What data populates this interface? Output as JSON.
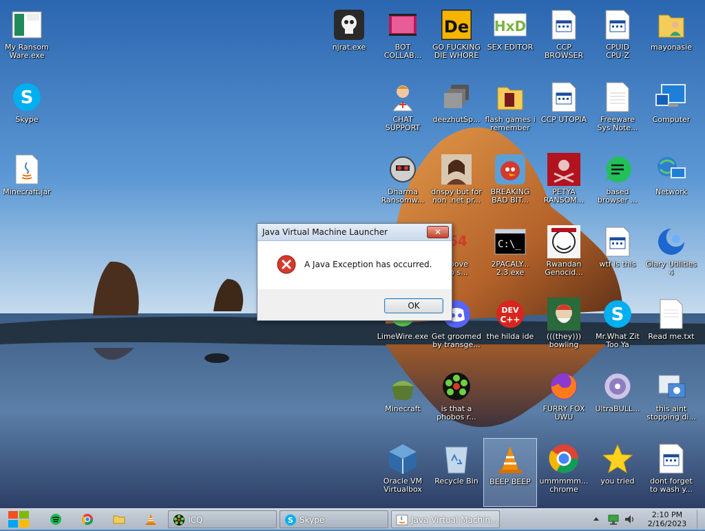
{
  "desktop": {
    "icons": [
      {
        "id": "my-ransomware",
        "label": "My Ransom\nWare.exe",
        "icon": "ransomware-app-icon"
      },
      {
        "id": "skype-left",
        "label": "Skype",
        "icon": "skype-icon"
      },
      {
        "id": "minecraft-jar",
        "label": "Minecraft.jar",
        "icon": "java-jar-icon"
      },
      {
        "id": "njrat",
        "label": "njrat.exe",
        "icon": "skull-icon"
      },
      {
        "id": "bot-collab",
        "label": "BOT\nCOLLAB...",
        "icon": "film-icon"
      },
      {
        "id": "go-fucking",
        "label": "GO FUCKING\nDIE WHORE",
        "icon": "de-logo-icon"
      },
      {
        "id": "sex-editor",
        "label": "SEX EDITOR",
        "icon": "hxd-icon"
      },
      {
        "id": "ccp-browser",
        "label": "CCP\nBROWSER",
        "icon": "app-window-icon"
      },
      {
        "id": "cpuid",
        "label": "CPUID\nCPU-Z",
        "icon": "app-window-icon"
      },
      {
        "id": "mayonasie",
        "label": "mayonasie",
        "icon": "user-folder-icon"
      },
      {
        "id": "chat-support",
        "label": "CHAT\nSUPPORT",
        "icon": "doctor-icon"
      },
      {
        "id": "deezhutsp",
        "label": "deezhutSp...",
        "icon": "stacked-windows-icon"
      },
      {
        "id": "flash-games",
        "label": "flash games i\nremember",
        "icon": "folder-icon"
      },
      {
        "id": "ccp-utopia",
        "label": "CCP UTOPIA",
        "icon": "app-window-icon"
      },
      {
        "id": "freeware",
        "label": "Freeware\nSys Note...",
        "icon": "document-icon"
      },
      {
        "id": "computer",
        "label": "Computer",
        "icon": "computer-icon"
      },
      {
        "id": "dharma",
        "label": "Dharma\nRansomw...",
        "icon": "robot-skull-icon"
      },
      {
        "id": "dnspy",
        "label": "dnspy but for\nnon .net pr...",
        "icon": "portrait-icon"
      },
      {
        "id": "breaking-bad",
        "label": "BREAKING\nBAD BIT...",
        "icon": "angry-bird-icon"
      },
      {
        "id": "petya",
        "label": "PETYA\nRANSOM...",
        "icon": "red-skull-icon"
      },
      {
        "id": "based-browser",
        "label": "based\nbrowser ...",
        "icon": "green-chat-icon"
      },
      {
        "id": "network",
        "label": "Network",
        "icon": "network-icon"
      },
      {
        "id": "above",
        "label": "above\nno s...",
        "icon": "hidden-icon"
      },
      {
        "id": "2pacaly",
        "label": "2PACALY...\n2.3.exe",
        "icon": "cmd-icon"
      },
      {
        "id": "rwandan",
        "label": "Rwandan\nGenocid...",
        "icon": "meme-face-icon"
      },
      {
        "id": "wtf",
        "label": "wtf is this",
        "icon": "app-window-icon"
      },
      {
        "id": "glary",
        "label": "Glary Utilities\n4",
        "icon": "glary-icon"
      },
      {
        "id": "limewire",
        "label": "LimeWire.exe",
        "icon": "limewire-icon"
      },
      {
        "id": "get-groomed",
        "label": "Get groomed\nby transge...",
        "icon": "discord-icon"
      },
      {
        "id": "hilda-ide",
        "label": "the hilda ide",
        "icon": "devcpp-icon"
      },
      {
        "id": "they-bowling",
        "label": "(((they)))\nbowling",
        "icon": "bowling-game-icon"
      },
      {
        "id": "mr-what",
        "label": "Mr.What Zit\nToo Ya",
        "icon": "skype-icon"
      },
      {
        "id": "readme",
        "label": "Read me.txt",
        "icon": "text-file-icon"
      },
      {
        "id": "minecraft",
        "label": "Minecraft",
        "icon": "grass-block-icon"
      },
      {
        "id": "phobos",
        "label": "is that a\nphobos r...",
        "icon": "icq-flower-icon"
      },
      {
        "id": "furry-fox",
        "label": "FURRY FOX\nUWU",
        "icon": "firefox-icon"
      },
      {
        "id": "ultrabull",
        "label": "UltraBULL...",
        "icon": "disc-icon"
      },
      {
        "id": "this-aint",
        "label": "this aint\nstopping di...",
        "icon": "installer-icon"
      },
      {
        "id": "virtualbox",
        "label": "Oracle VM\nVirtualbox",
        "icon": "virtualbox-icon"
      },
      {
        "id": "recycle-bin",
        "label": "Recycle Bin",
        "icon": "recycle-bin-icon"
      },
      {
        "id": "beep-beep",
        "label": "BEEP BEEP",
        "icon": "vlc-cone-icon"
      },
      {
        "id": "chrome",
        "label": "ummmmm...\nchrome",
        "icon": "chrome-icon"
      },
      {
        "id": "you-tried",
        "label": "you tried",
        "icon": "star-icon"
      },
      {
        "id": "wash",
        "label": "dont forget\nto wash y...",
        "icon": "app-window-icon"
      }
    ]
  },
  "dialog": {
    "title": "Java Virtual Machine Launcher",
    "close_label": "✕",
    "message": "A Java Exception has occurred.",
    "ok_label": "OK",
    "icon": "error-icon"
  },
  "taskbar": {
    "quick_launch": [
      "spotify-icon",
      "chrome-icon",
      "folder-icon",
      "vlc-cone-icon"
    ],
    "buttons": [
      {
        "label": "ICQ",
        "icon": "icq-flower-icon"
      },
      {
        "label": "Skype",
        "icon": "skype-icon"
      },
      {
        "label": "Java Virtual Machin...",
        "icon": "java-icon"
      }
    ],
    "tray": [
      "chevron-up-icon",
      "network-tray-icon",
      "volume-icon"
    ],
    "time": "2:10 PM",
    "date": "2/16/2023"
  },
  "colors": {
    "sky_top": "#2f6fb8",
    "sky_bottom": "#cfe3f3",
    "rock": "#c9782e",
    "error_red": "#d33a2c",
    "taskbar": "#b7c1cc"
  }
}
